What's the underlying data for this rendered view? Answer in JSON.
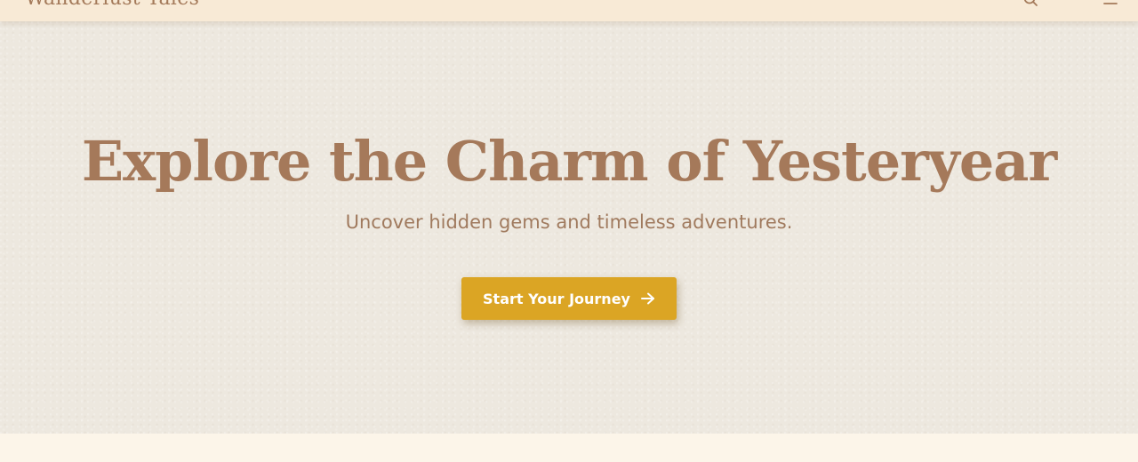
{
  "navbar": {
    "brand": "Wanderlust Tales",
    "icons": [
      "search-icon",
      "menu-icon"
    ]
  },
  "hero": {
    "title": "Explore the Charm of Yesteryear",
    "subtitle": "Uncover hidden gems and timeless adventures.",
    "cta_label": "Start Your Journey",
    "cta_icon": "arrow-right-icon"
  },
  "colors": {
    "nav_background": "#f8ead6",
    "hero_background": "#ede8df",
    "title_text": "#a5795a",
    "accent_button": "#dba524",
    "page_background": "#fcf5e9"
  }
}
